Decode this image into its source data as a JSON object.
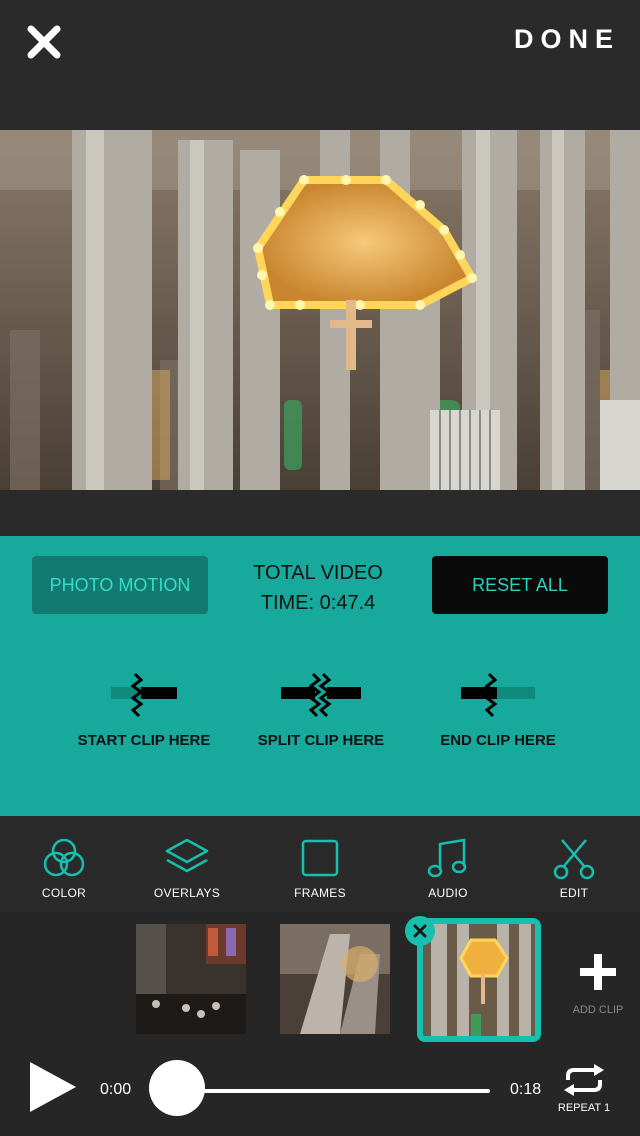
{
  "header": {
    "close_icon": "close-icon",
    "done_label": "DONE"
  },
  "panel": {
    "photo_motion_label": "PHOTO MOTION",
    "total_video_line1": "TOTAL VIDEO",
    "total_video_line2": "TIME:  0:47.4",
    "reset_all_label": "RESET ALL",
    "actions": [
      {
        "label": "START CLIP HERE",
        "icon": "start-clip-icon"
      },
      {
        "label": "SPLIT CLIP HERE",
        "icon": "split-clip-icon"
      },
      {
        "label": "END CLIP HERE",
        "icon": "end-clip-icon"
      }
    ]
  },
  "toolbar": {
    "items": [
      {
        "label": "COLOR",
        "icon": "color-icon"
      },
      {
        "label": "OVERLAYS",
        "icon": "overlays-icon"
      },
      {
        "label": "FRAMES",
        "icon": "frames-icon"
      },
      {
        "label": "AUDIO",
        "icon": "audio-icon"
      },
      {
        "label": "EDIT",
        "icon": "scissors-icon",
        "active": true
      }
    ]
  },
  "clips": {
    "count_visible": 3,
    "selected_index": 2,
    "add_clip_label": "ADD CLIP"
  },
  "player": {
    "current_time": "0:00",
    "end_time": "0:18",
    "progress": 0,
    "repeat_label": "REPEAT 1"
  },
  "colors": {
    "accent": "#17a99b",
    "accent_dark": "#127a70",
    "background": "#262626"
  }
}
